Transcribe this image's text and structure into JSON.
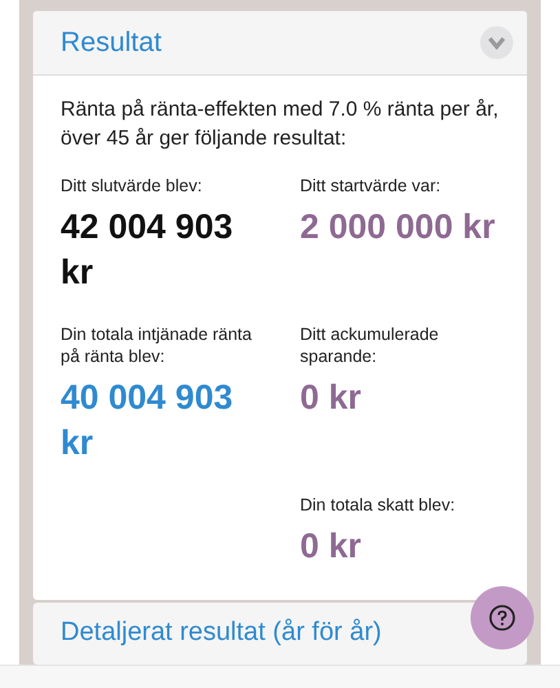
{
  "result_panel": {
    "title": "Resultat",
    "expanded": true,
    "summary": "Ränta på ränta-effekten med 7.0 % ränta per år, över 45 år ger följande resultat:",
    "figures": [
      {
        "kind": "figure",
        "label": "Ditt slutvärde blev:",
        "value": "42 004 903 kr",
        "color": "#111111"
      },
      {
        "kind": "figure",
        "label": "Ditt startvärde var:",
        "value": "2 000 000 kr",
        "color": "#8e6a93"
      },
      {
        "kind": "figure",
        "label": "Din totala intjänade ränta på ränta blev:",
        "value": "40 004 903 kr",
        "color": "#2f8ad0"
      },
      {
        "kind": "figure",
        "label": "Ditt ackumulerade sparande:",
        "value": "0 kr",
        "color": "#8e6a93"
      },
      {
        "kind": "blank"
      },
      {
        "kind": "figure",
        "label": "Din totala skatt blev:",
        "value": "0 kr",
        "color": "#8e6a93"
      }
    ]
  },
  "detail_panel": {
    "title": "Detaljerat resultat (år för år)"
  }
}
